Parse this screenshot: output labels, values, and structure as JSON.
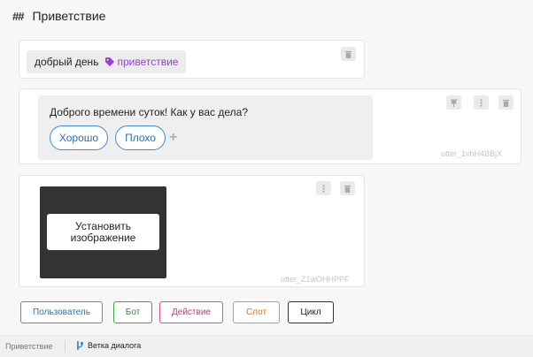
{
  "header": {
    "hash": "##",
    "title": "Приветствие"
  },
  "user_message": {
    "text": "добрый день",
    "intent": "приветствие"
  },
  "bot_message": {
    "text": "Доброго времени суток! Как у вас дела?",
    "quick_replies": [
      "Хорошо",
      "Плохо"
    ],
    "utter_id": "utter_1vhH4BBjX"
  },
  "image_message": {
    "button_label_line1": "Установить",
    "button_label_line2": "изображение",
    "utter_id": "utter_Z1wOHHPPF"
  },
  "toolbar": {
    "user_label": "Пользователь",
    "bot_label": "Бот",
    "action_label": "Действие",
    "slot_label": "Слот",
    "loop_label": "Цикл"
  },
  "footer": {
    "breadcrumb": "Приветствие",
    "branch_label": "Ветка диалога"
  },
  "colors": {
    "intent": "#9b3bdb",
    "quick_reply_border": "#3a8be0",
    "user_btn": "#4a90d9",
    "bot_btn": "#3aa845",
    "action_btn": "#e0508a",
    "slot_btn": "#f08a3c",
    "loop_btn": "#333333"
  }
}
